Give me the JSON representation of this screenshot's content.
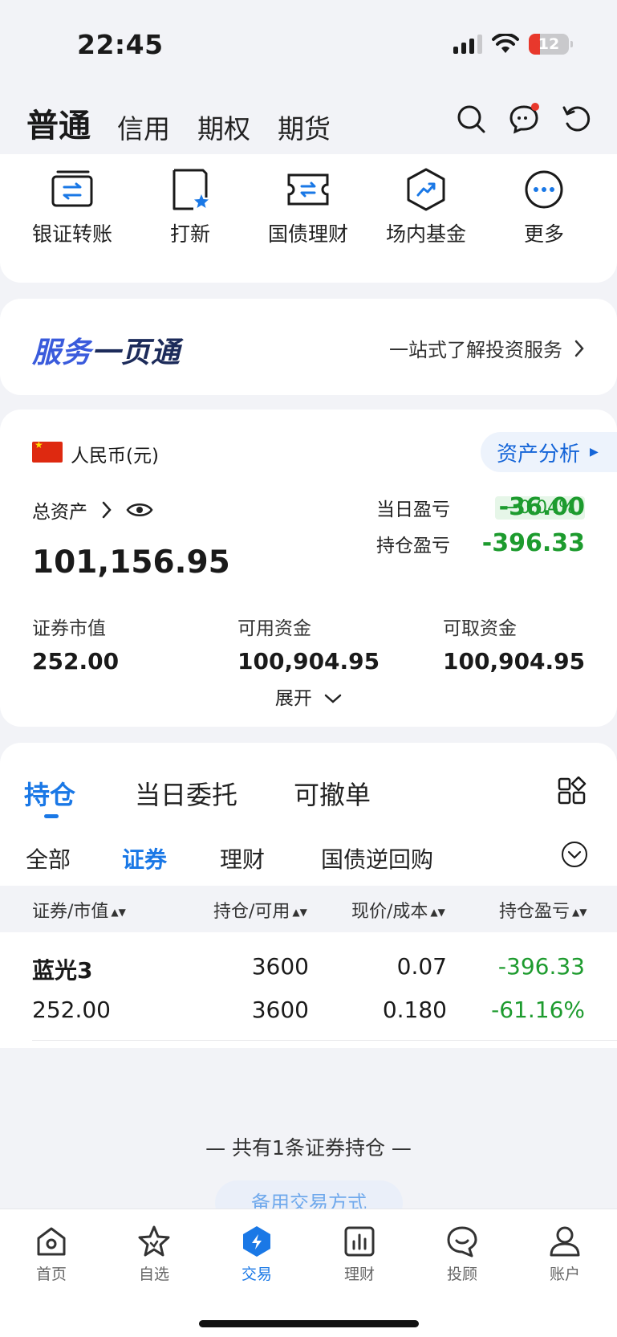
{
  "status": {
    "time": "22:45",
    "battery": "12"
  },
  "topnav": {
    "tabs": [
      "普通",
      "信用",
      "期权",
      "期货"
    ]
  },
  "quick_actions": [
    {
      "label": "银证转账",
      "icon": "transfer-icon"
    },
    {
      "label": "打新",
      "icon": "ipo-icon"
    },
    {
      "label": "国债理财",
      "icon": "bond-icon"
    },
    {
      "label": "场内基金",
      "icon": "fund-icon"
    },
    {
      "label": "更多",
      "icon": "more-icon"
    }
  ],
  "service": {
    "title_a": "服务",
    "title_b": "一页通",
    "link": "一站式了解投资服务"
  },
  "asset": {
    "currency": "人民币(元)",
    "analysis": "资产分析",
    "total_label": "总资产",
    "total_value": "101,156.95",
    "change_pct": "−0.04%",
    "daily_pl_label": "当日盈亏",
    "daily_pl": "-36.00",
    "hold_pl_label": "持仓盈亏",
    "hold_pl": "-396.33",
    "market_value_label": "证券市值",
    "market_value": "252.00",
    "available_label": "可用资金",
    "available": "100,904.95",
    "withdrawable_label": "可取资金",
    "withdrawable": "100,904.95",
    "expand": "展开"
  },
  "holdings": {
    "tabs": [
      "持仓",
      "当日委托",
      "可撤单"
    ],
    "filters": [
      "全部",
      "证券",
      "理财",
      "国债逆回购"
    ],
    "columns": [
      "证券/市值",
      "持仓/可用",
      "现价/成本",
      "持仓盈亏"
    ],
    "rows": [
      {
        "name": "蓝光3",
        "value": "252.00",
        "position": "3600",
        "available": "3600",
        "price": "0.07",
        "cost": "0.180",
        "pl": "-396.33",
        "pl_pct": "-61.16%"
      }
    ],
    "footer": "— 共有1条证券持仓 —",
    "backup": "备用交易方式"
  },
  "tabbar": [
    {
      "label": "首页",
      "icon": "home-icon"
    },
    {
      "label": "自选",
      "icon": "star-icon"
    },
    {
      "label": "交易",
      "icon": "trade-icon"
    },
    {
      "label": "理财",
      "icon": "chart-icon"
    },
    {
      "label": "投顾",
      "icon": "advisor-icon"
    },
    {
      "label": "账户",
      "icon": "user-icon"
    }
  ],
  "colors": {
    "accent": "#1a78e6",
    "loss_green": "#1d9b2e"
  }
}
